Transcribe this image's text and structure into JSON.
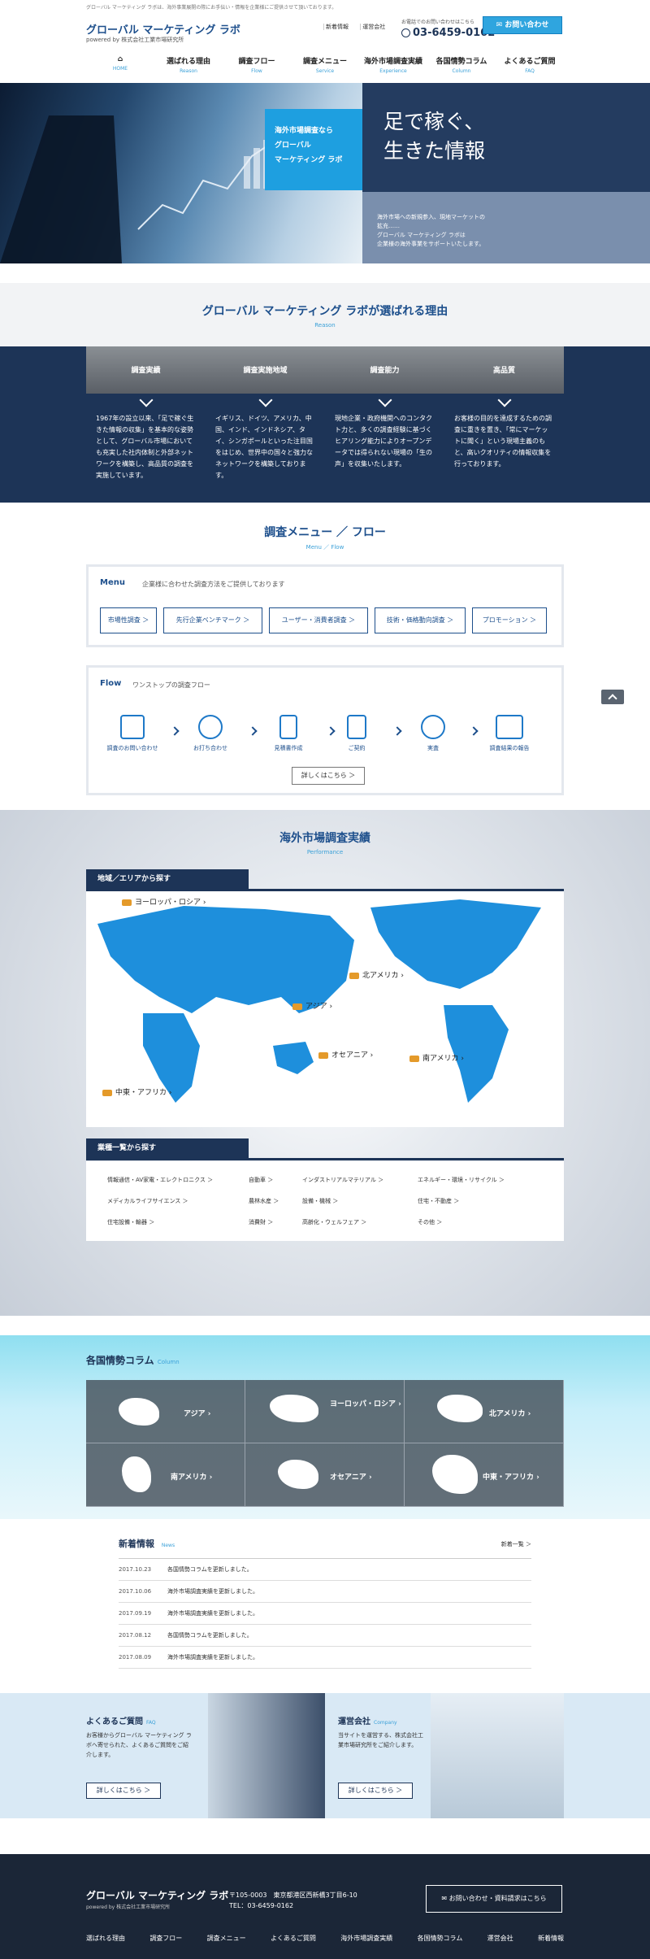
{
  "top_note": "グローバル マーケティング ラボは、海外事業展開の際にお手伝い・情報を企業様にご提供させて頂いております。",
  "header": {
    "logo": "グローバル マーケティング ラボ",
    "logo_sub": "powered by 株式会社工業市場研究所",
    "links": [
      "新着情報",
      "運営会社"
    ],
    "tel_note": "お電話でのお問い合わせはこちら",
    "tel": "03-6459-0162",
    "contact_label": "お問い合わせ"
  },
  "nav": [
    {
      "label": "選ばれる理由",
      "en": "Reason"
    },
    {
      "label": "調査フロー",
      "en": "Flow"
    },
    {
      "label": "調査メニュー",
      "en": "Service"
    },
    {
      "label": "海外市場調査実績",
      "en": "Experience"
    },
    {
      "label": "各国情勢コラム",
      "en": "Column"
    },
    {
      "label": "よくあるご質問",
      "en": "FAQ"
    }
  ],
  "nav_home_en": "HOME",
  "hero": {
    "title_line1": "足で稼ぐ、",
    "title_line2": "生きた情報",
    "box_line1": "海外市場調査なら",
    "box_line2": "グローバル",
    "box_line3": "マーケティング ラボ",
    "text_line1": "海外市場への新規参入、現地マーケットの",
    "text_line2": "拡充……",
    "text_line3": "グローバル マーケティング ラボは",
    "text_line4": "企業様の海外事業をサポートいたします。"
  },
  "reason": {
    "title": "グローバル マーケティング ラボが選ばれる理由",
    "sub": "Reason",
    "cards": [
      {
        "head": "調査実績",
        "text": "1967年の設立以来、「足で稼ぐ生きた情報の収集」を基本的な姿勢として、グローバル市場においても充実した社内体制と外部ネットワークを構築し、高品質の調査を実施しています。"
      },
      {
        "head": "調査実施地域",
        "text": "イギリス、ドイツ、アメリカ、中国、インド、インドネシア、タイ、シンガポールといった注目国をはじめ、世界中の国々と強力なネットワークを構築しております。"
      },
      {
        "head": "調査能力",
        "text": "現地企業・政府機関へのコンタクト力と、多くの調査経験に基づくヒアリング能力によりオープンデータでは得られない現場の「生の声」を収集いたします。"
      },
      {
        "head": "高品質",
        "text": "お客様の目的を達成するための調査に重きを置き、「常にマーケットに聞く」という現場主義のもと、高いクオリティの情報収集を行っております。"
      }
    ]
  },
  "menu_flow": {
    "title": "調査メニュー ／ フロー",
    "sub": "Menu ／ Flow",
    "menu_label": "Menu",
    "menu_desc": "企業様に合わせた調査方法をご提供しております",
    "menu_items": [
      "市場性調査 ＞",
      "先行企業ベンチマーク ＞",
      "ユーザー・消費者調査 ＞",
      "技術・価格動向調査 ＞",
      "プロモーション ＞"
    ],
    "flow_label": "Flow",
    "flow_desc": "ワンストップの調査フロー",
    "flow_steps": [
      "調査のお問い合わせ",
      "お打ち合わせ",
      "見積書作成",
      "ご契約",
      "実査",
      "調査結果の報告"
    ],
    "flow_icons": [
      "mail-icon",
      "meeting-icon",
      "document-icon",
      "contract-icon",
      "globe-icon",
      "folder-icon"
    ],
    "detail_label": "詳しくはこちら ＞"
  },
  "performance": {
    "title": "海外市場調査実績",
    "sub": "Performance",
    "region_tab": "地域／エリアから探す",
    "regions": [
      "ヨーロッパ・ロシア ›",
      "北アメリカ ›",
      "アジア ›",
      "オセアニア ›",
      "南アメリカ ›",
      "中東・アフリカ ›"
    ],
    "industry_tab": "業種一覧から探す",
    "industries": [
      "情報通信・AV家電・エレクトロニクス ＞",
      "自動車 ＞",
      "インダストリアルマテリアル ＞",
      "エネルギー・環境・リサイクル ＞",
      "メディカルライフサイエンス ＞",
      "農林水産 ＞",
      "設備・機械 ＞",
      "住宅・不動産 ＞",
      "住宅設備・輸器 ＞",
      "消費財 ＞",
      "高齢化・ウェルフェア ＞",
      "その他 ＞"
    ]
  },
  "column": {
    "title": "各国情勢コラム",
    "sub": "Column",
    "cells": [
      "アジア ›",
      "ヨーロッパ・ロシア ›",
      "北アメリカ ›",
      "南アメリカ ›",
      "オセアニア ›",
      "中東・アフリカ ›"
    ]
  },
  "news": {
    "title": "新着情報",
    "sub": "News",
    "more": "新着一覧 ＞",
    "items": [
      {
        "date": "2017.10.23",
        "text": "各国情勢コラムを更新しました。"
      },
      {
        "date": "2017.10.06",
        "text": "海外市場調査実績を更新しました。"
      },
      {
        "date": "2017.09.19",
        "text": "海外市場調査実績を更新しました。"
      },
      {
        "date": "2017.08.12",
        "text": "各国情勢コラムを更新しました。"
      },
      {
        "date": "2017.08.09",
        "text": "海外市場調査実績を更新しました。"
      }
    ]
  },
  "faq": {
    "title": "よくあるご質問",
    "en": "FAQ",
    "desc": "お客様からグローバル マーケティング ラボへ寄せられた、よくあるご質問をご紹介します。",
    "btn": "詳しくはこちら ＞"
  },
  "company": {
    "title": "運営会社",
    "en": "Company",
    "desc": "当サイトを運営する、株式会社工業市場研究所をご紹介します。",
    "btn": "詳しくはこちら ＞"
  },
  "footer": {
    "logo": "グローバル マーケティング ラボ",
    "logo_sub": "powered by 株式会社工業市場研究所",
    "addr1": "〒105-0003　東京都港区西新橋3丁目6-10",
    "addr2": "TEL：03-6459-0162",
    "btn": "お問い合わせ・資料請求はこちら",
    "nav": [
      "選ばれる理由",
      "調査フロー",
      "調査メニュー",
      "よくあるご質問",
      "海外市場調査実績",
      "各国情勢コラム",
      "運営会社",
      "新着情報"
    ]
  }
}
